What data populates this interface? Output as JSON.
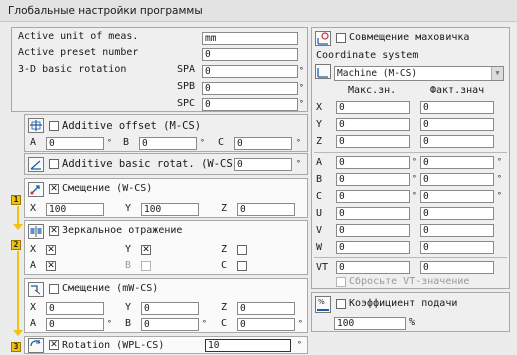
{
  "window": {
    "title": "Глобальные настройки программы"
  },
  "general": {
    "unit_label": "Active unit of meas.",
    "unit_value": "mm",
    "preset_label": "Active preset number",
    "preset_value": "0",
    "rotation_label": "3-D basic rotation",
    "spa_label": "SPA",
    "spa_value": "0",
    "spb_label": "SPB",
    "spb_value": "0",
    "spc_label": "SPC",
    "spc_value": "0",
    "deg": "°"
  },
  "additive_offset": {
    "label": "Additive offset (M-CS)",
    "a_label": "A",
    "a_value": "0",
    "b_label": "B",
    "b_value": "0",
    "c_label": "C",
    "c_value": "0"
  },
  "additive_rotation": {
    "label": "Additive basic rotat. (W-CS)",
    "value": "0"
  },
  "shift": {
    "label": "Смещение (W-CS)",
    "x_label": "X",
    "x_value": "100",
    "y_label": "Y",
    "y_value": "100",
    "z_label": "Z",
    "z_value": "0"
  },
  "mirror": {
    "label": "Зеркальное отражение",
    "x_label": "X",
    "y_label": "Y",
    "z_label": "Z",
    "a_label": "A",
    "b_label": "B",
    "c_label": "C"
  },
  "shift_mw": {
    "label": "Смещение (mW-CS)",
    "x_label": "X",
    "x_value": "0",
    "y_label": "Y",
    "y_value": "0",
    "z_label": "Z",
    "z_value": "0",
    "a_label": "A",
    "a_value": "0",
    "b_label": "B",
    "b_value": "0",
    "c_label": "C",
    "c_value": "0"
  },
  "rotation_wpl": {
    "label": "Rotation (WPL-CS)",
    "value": "10"
  },
  "badges": [
    "1",
    "2",
    "3"
  ],
  "handwheel": {
    "label": "Совмещение маховичка",
    "coord_system_label": "Coordinate system",
    "coord_system_value": "Machine (M-CS)",
    "col_max": "Макс.зн.",
    "col_actual": "Факт.знач",
    "rows": [
      {
        "axis": "X",
        "max": "0",
        "act": "0"
      },
      {
        "axis": "Y",
        "max": "0",
        "act": "0"
      },
      {
        "axis": "Z",
        "max": "0",
        "act": "0"
      }
    ],
    "rot_rows": [
      {
        "axis": "A",
        "max": "0",
        "act": "0"
      },
      {
        "axis": "B",
        "max": "0",
        "act": "0"
      },
      {
        "axis": "C",
        "max": "0",
        "act": "0"
      }
    ],
    "aux_rows": [
      {
        "axis": "U",
        "max": "0",
        "act": "0"
      },
      {
        "axis": "V",
        "max": "0",
        "act": "0"
      },
      {
        "axis": "W",
        "max": "0",
        "act": "0"
      }
    ],
    "vt_label": "VT",
    "vt_max": "0",
    "vt_act": "0",
    "reset_vt_label": "Сбросьте VT-значение"
  },
  "feed": {
    "label": "Коэффициент подачи",
    "value": "100",
    "unit": "%"
  }
}
